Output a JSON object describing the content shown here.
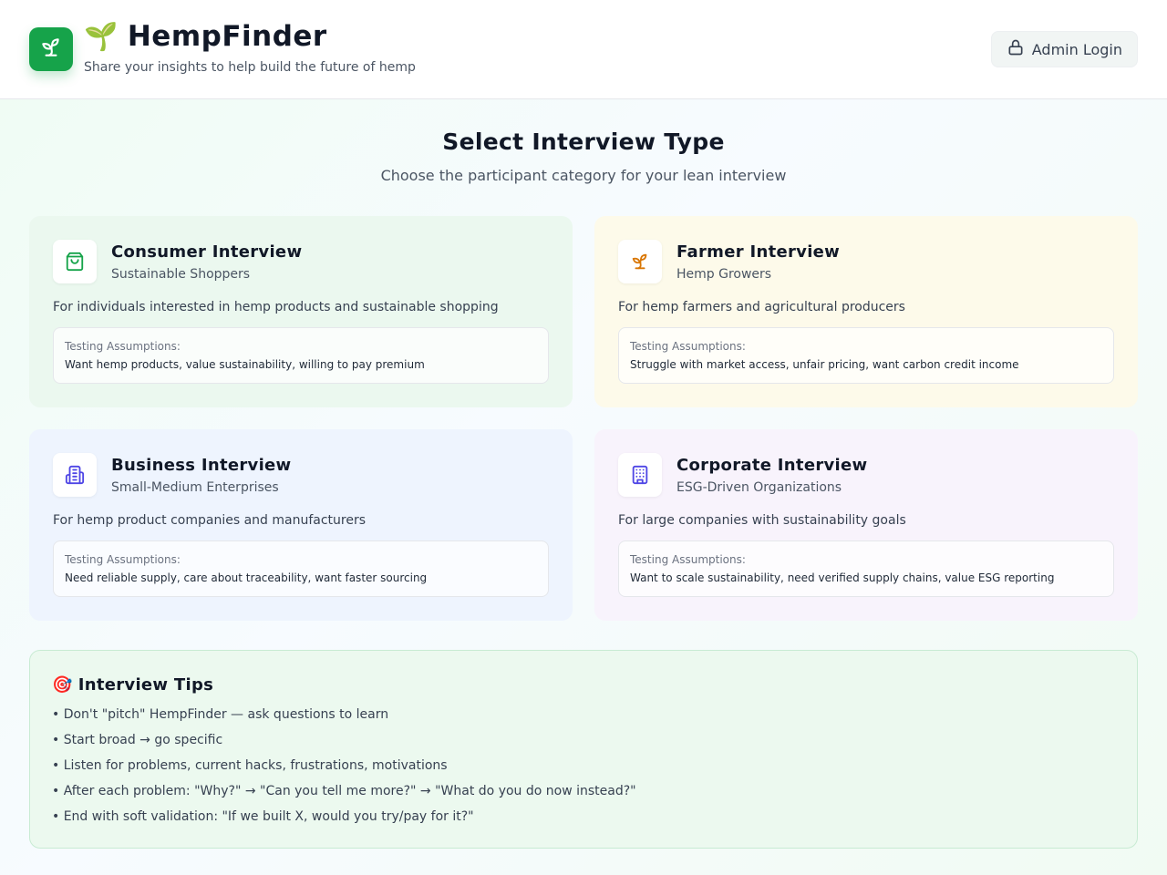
{
  "header": {
    "app_name": "HempFinder",
    "title_emoji": "🌱",
    "subtitle": "Share your insights to help build the future of hemp",
    "admin_button": "Admin Login",
    "logo_icon": "sprout-icon",
    "brand_color": "#16a34a"
  },
  "main": {
    "title": "Select Interview Type",
    "subtitle": "Choose the participant category for your lean interview"
  },
  "assumptions_label": "Testing Assumptions:",
  "cards": [
    {
      "title": "Consumer Interview",
      "subtitle": "Sustainable Shoppers",
      "description": "For individuals interested in hemp products and sustainable shopping",
      "assumptions": "Want hemp products, value sustainability, willing to pay premium",
      "icon": "shopping-bag-icon",
      "icon_color": "#16a34a"
    },
    {
      "title": "Farmer Interview",
      "subtitle": "Hemp Growers",
      "description": "For hemp farmers and agricultural producers",
      "assumptions": "Struggle with market access, unfair pricing, want carbon credit income",
      "icon": "sprout-icon",
      "icon_color": "#d97706"
    },
    {
      "title": "Business Interview",
      "subtitle": "Small-Medium Enterprises",
      "description": "For hemp product companies and manufacturers",
      "assumptions": "Need reliable supply, care about traceability, want faster sourcing",
      "icon": "buildings-icon",
      "icon_color": "#4f46e5"
    },
    {
      "title": "Corporate Interview",
      "subtitle": "ESG-Driven Organizations",
      "description": "For large companies with sustainability goals",
      "assumptions": "Want to scale sustainability, need verified supply chains, value ESG reporting",
      "icon": "office-building-icon",
      "icon_color": "#4f46e5"
    }
  ],
  "tips": {
    "emoji": "🎯",
    "title": "Interview Tips",
    "items": [
      "• Don't \"pitch\" HempFinder — ask questions to learn",
      "• Start broad → go specific",
      "• Listen for problems, current hacks, frustrations, motivations",
      "• After each problem: \"Why?\" → \"Can you tell me more?\" → \"What do you do now instead?\"",
      "• End with soft validation: \"If we built X, would you try/pay for it?\""
    ]
  }
}
